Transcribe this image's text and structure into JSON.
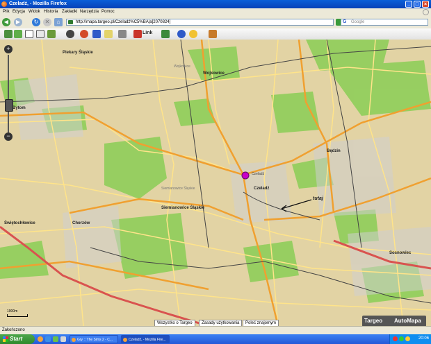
{
  "window": {
    "title": "Czeladź, - Mozilla Firefox"
  },
  "menu": {
    "items": [
      "Plik",
      "Edycja",
      "Widok",
      "Historia",
      "Zakładki",
      "Narzędzia",
      "Pomoc"
    ]
  },
  "navbar": {
    "url": "http://mapa.targeo.pl/Czeladź%C5%BA|a[2070824]",
    "search_placeholder": "Google"
  },
  "toolbar": {
    "link_label": "Link"
  },
  "map": {
    "places": {
      "piekary": "Piekary Śląskie",
      "wojkowice_gray": "Wojkowice",
      "wojkowice": "Wojkowice",
      "bytom": "Bytom",
      "bedzin": "Będzin",
      "czeladz_pin": "Czeladź",
      "czeladz": "Czeladź",
      "siemianowice_gray": "Siemianowice Śląskie",
      "siemianowice": "Siemianowice Śląskie",
      "chorzow": "Chorzów",
      "swietochlowice": "Świętochłowice",
      "sosnowiec": "Sosnowiec",
      "tutaj": "tutaj"
    },
    "scale_label": "1000m",
    "footer_links": [
      "Wszystko o Targeo",
      "Zasady użytkowania",
      "Poleć znajomym"
    ],
    "brand": {
      "targeo": "Targeo",
      "automapa": "AutoMapa"
    },
    "colors": {
      "base": "#e2d3a4",
      "green": "#8fce5a",
      "road_major": "#f0a030",
      "road_minor": "#ffe48a",
      "motorway": "#d9534f",
      "rail": "#444444",
      "pin": "#c800c8"
    }
  },
  "status": {
    "text": "Zakończono"
  },
  "taskbar": {
    "start_label": "Start",
    "tasks": [
      "Gry :: The Sims 2 - C...",
      "Czeladź, - Mozilla Fire..."
    ],
    "clock": "20:06"
  }
}
